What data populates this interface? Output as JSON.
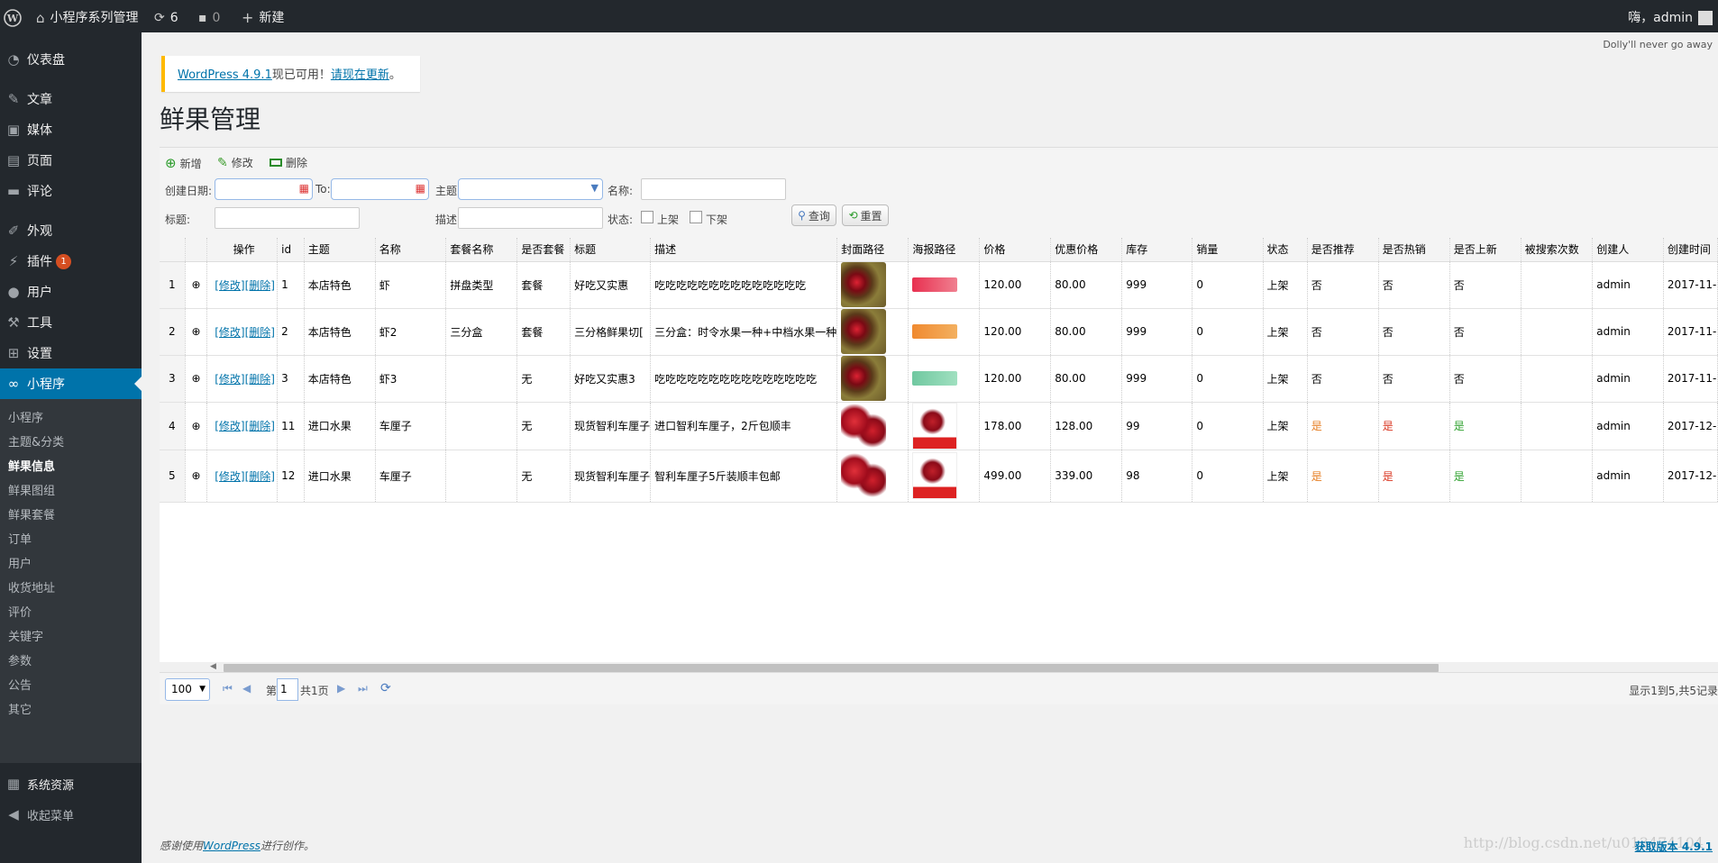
{
  "adminbar": {
    "site_title": "小程序系列管理",
    "updates_count": "6",
    "comments_count": "0",
    "new_label": "新建",
    "greeting": "嗨，admin"
  },
  "sidebar": {
    "items": [
      {
        "label": "仪表盘",
        "icon": "dashboard-icon"
      },
      {
        "label": "文章",
        "icon": "pin-icon"
      },
      {
        "label": "媒体",
        "icon": "media-icon"
      },
      {
        "label": "页面",
        "icon": "page-icon"
      },
      {
        "label": "评论",
        "icon": "comment-icon"
      },
      {
        "label": "外观",
        "icon": "brush-icon"
      },
      {
        "label": "插件",
        "icon": "plugin-icon",
        "badge": "1"
      },
      {
        "label": "用户",
        "icon": "user-icon"
      },
      {
        "label": "工具",
        "icon": "wrench-icon"
      },
      {
        "label": "设置",
        "icon": "settings-icon"
      },
      {
        "label": "小程序",
        "icon": "link-icon"
      }
    ],
    "submenu": [
      "小程序",
      "主题&分类",
      "鲜果信息",
      "鲜果图组",
      "鲜果套餐",
      "订单",
      "用户",
      "收货地址",
      "评价",
      "关键字",
      "参数",
      "公告",
      "其它"
    ],
    "bottom": [
      {
        "label": "系统资源",
        "icon": "server-icon"
      },
      {
        "label": "收起菜单",
        "icon": "collapse-icon"
      }
    ]
  },
  "dolly": "Dolly'll never go away",
  "notice": {
    "version_link": "WordPress 4.9.1",
    "text": "现已可用！",
    "update_link": "请现在更新",
    "end": "。"
  },
  "page_title": "鲜果管理",
  "toolbar": {
    "add": "新增",
    "edit": "修改",
    "delete": "删除",
    "created_date": "创建日期:",
    "to": "To:",
    "theme": "主题:",
    "name": "名称:",
    "title": "标题:",
    "desc": "描述:",
    "status": "状态:",
    "on_shelf": "上架",
    "off_shelf": "下架",
    "search": "查询",
    "reset": "重置"
  },
  "table": {
    "headers": [
      "操作",
      "id",
      "主题",
      "名称",
      "套餐名称",
      "是否套餐",
      "标题",
      "描述",
      "封面路径",
      "海报路径",
      "价格",
      "优惠价格",
      "库存",
      "销量",
      "状态",
      "是否推荐",
      "是否热销",
      "是否上新",
      "被搜索次数",
      "创建人",
      "创建时间"
    ],
    "op_edit": "[修改]",
    "op_delete": "[删除]",
    "rows": [
      {
        "n": "1",
        "id": "1",
        "theme": "本店特色",
        "name": "虾",
        "combo": "拼盘类型",
        "is_combo": "套餐",
        "title": "好吃又实惠",
        "desc": "吃吃吃吃吃吃吃吃吃吃吃吃吃吃",
        "price": "120.00",
        "discount": "80.00",
        "stock": "999",
        "sales": "0",
        "status": "上架",
        "rec": "否",
        "hot": "否",
        "new": "否",
        "searches": "",
        "creator": "admin",
        "created": "2017-11-"
      },
      {
        "n": "2",
        "id": "2",
        "theme": "本店特色",
        "name": "虾2",
        "combo": "三分盒",
        "is_combo": "套餐",
        "title": "三分格鲜果切[",
        "desc": "三分盒：时令水果一种+中档水果一种",
        "price": "120.00",
        "discount": "80.00",
        "stock": "999",
        "sales": "0",
        "status": "上架",
        "rec": "否",
        "hot": "否",
        "new": "否",
        "searches": "",
        "creator": "admin",
        "created": "2017-11-"
      },
      {
        "n": "3",
        "id": "3",
        "theme": "本店特色",
        "name": "虾3",
        "combo": "",
        "is_combo": "无",
        "title": "好吃又实惠3",
        "desc": "吃吃吃吃吃吃吃吃吃吃吃吃吃吃吃",
        "price": "120.00",
        "discount": "80.00",
        "stock": "999",
        "sales": "0",
        "status": "上架",
        "rec": "否",
        "hot": "否",
        "new": "否",
        "searches": "",
        "creator": "admin",
        "created": "2017-11-"
      },
      {
        "n": "4",
        "id": "11",
        "theme": "进口水果",
        "name": "车厘子",
        "combo": "",
        "is_combo": "无",
        "title": "现货智利车厘子",
        "desc": "进口智利车厘子，2斤包顺丰",
        "price": "178.00",
        "discount": "128.00",
        "stock": "99",
        "sales": "0",
        "status": "上架",
        "rec": "是",
        "hot": "是",
        "new": "是",
        "searches": "",
        "creator": "admin",
        "created": "2017-12-"
      },
      {
        "n": "5",
        "id": "12",
        "theme": "进口水果",
        "name": "车厘子",
        "combo": "",
        "is_combo": "无",
        "title": "现货智利车厘子",
        "desc": "智利车厘子5斤装顺丰包邮",
        "price": "499.00",
        "discount": "339.00",
        "stock": "98",
        "sales": "0",
        "status": "上架",
        "rec": "是",
        "hot": "是",
        "new": "是",
        "searches": "",
        "creator": "admin",
        "created": "2017-12-"
      }
    ]
  },
  "pager": {
    "page_size": "100",
    "page_prefix": "第",
    "page": "1",
    "page_total": "共1页",
    "summary": "显示1到5,共5记录"
  },
  "footer": {
    "prefix": "感谢使用",
    "link": "WordPress",
    "suffix": "进行创作。",
    "version": "获取版本 4.9.1"
  },
  "watermark": "http://blog.csdn.net/u013474104",
  "colors": {
    "accent": "#0073aa",
    "adminbar": "#23282d",
    "yes_rec": "#e67e22",
    "yes_hot": "#d9341f",
    "yes_new": "#2ea12e"
  }
}
